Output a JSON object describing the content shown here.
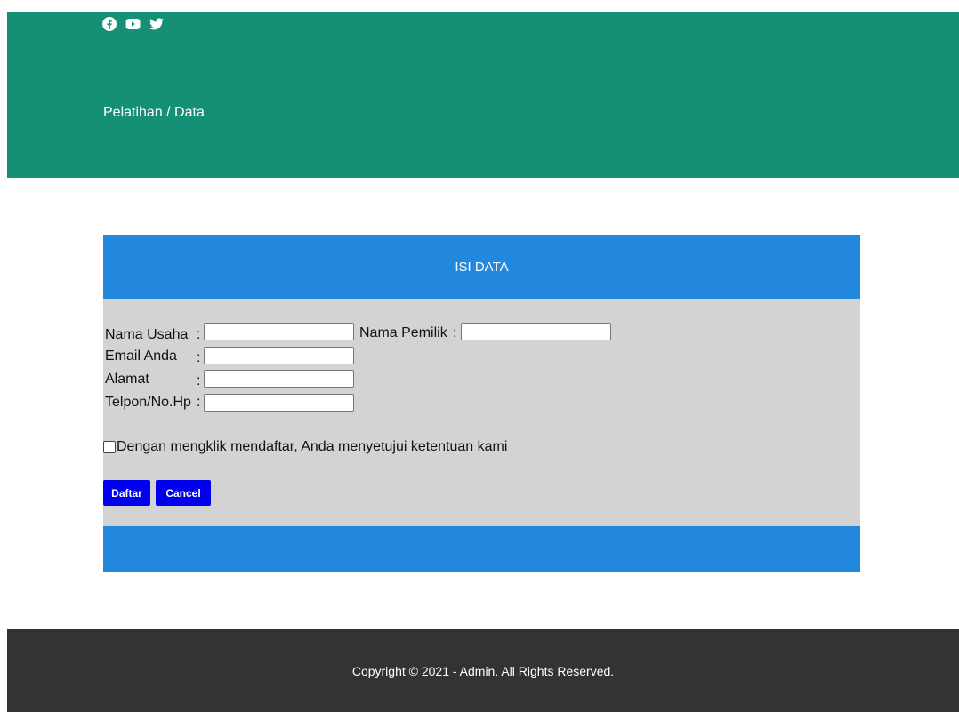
{
  "header": {
    "social_icons": [
      "facebook-icon",
      "youtube-icon",
      "twitter-icon"
    ],
    "breadcrumb": "Pelatihan / Data",
    "bg_color": "#158f76"
  },
  "form": {
    "title": "ISI DATA",
    "fields": {
      "nama_usaha": {
        "label": "Nama Usaha",
        "value": ""
      },
      "nama_pemilik": {
        "label": "Nama Pemilik",
        "value": ""
      },
      "email": {
        "label": "Email Anda",
        "value": ""
      },
      "alamat": {
        "label": "Alamat",
        "value": ""
      },
      "telpon": {
        "label": "Telpon/No.Hp",
        "value": ""
      }
    },
    "separator": ":",
    "agreement": "Dengan mengklik mendaftar, Anda menyetujui ketentuan kami",
    "agreement_checked": false,
    "buttons": {
      "submit": "Daftar",
      "cancel": "Cancel"
    },
    "accent_color": "#2288dd",
    "button_color": "#0000ee"
  },
  "footer": {
    "text": "Copyright © 2021 - Admin. All Rights Reserved.",
    "bg_color": "#333333"
  }
}
